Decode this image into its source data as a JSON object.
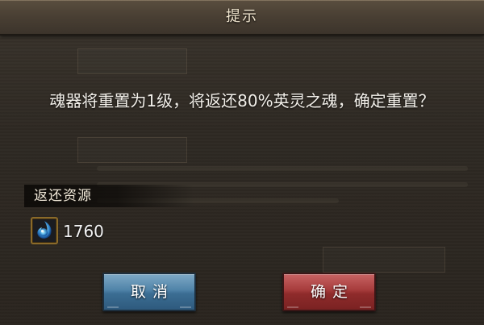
{
  "dialog": {
    "title": "提示",
    "message": "魂器将重置为1级，将返还80%英灵之魂，确定重置？"
  },
  "refund": {
    "section_label": "返还资源",
    "items": [
      {
        "icon": "soul-orb-icon",
        "amount": "1760"
      }
    ]
  },
  "buttons": {
    "cancel_label": "取消",
    "confirm_label": "确定"
  },
  "colors": {
    "cancel_button": "#4f83a8",
    "confirm_button": "#a63b3b",
    "title_bar": "#4a4034"
  }
}
